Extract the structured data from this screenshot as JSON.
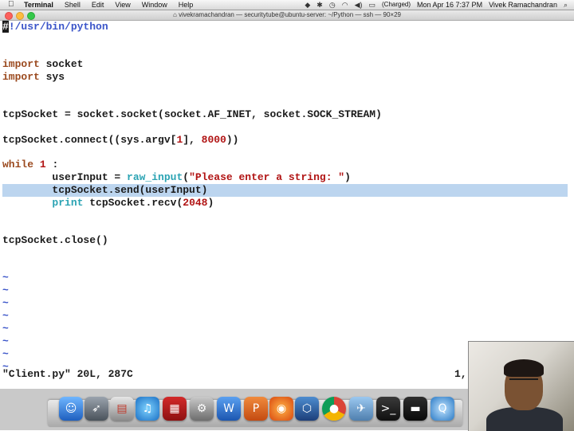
{
  "menubar": {
    "apple": "",
    "app_name": "Terminal",
    "menus": [
      "Shell",
      "Edit",
      "View",
      "Window",
      "Help"
    ],
    "battery": "(Charged)",
    "datetime": "Mon Apr 16  7:37 PM",
    "user": "Vivek Ramachandran"
  },
  "window": {
    "title": "vivekramachandran — securitytube@ubuntu-server: ~/Python — ssh — 90×29"
  },
  "editor": {
    "lines": {
      "shebang_cursor": "#",
      "shebang_rest": "!/usr/bin/python",
      "import1_kw": "import",
      "import1_mod": " socket",
      "import2_kw": "import",
      "import2_mod": " sys",
      "sock_line": "tcpSocket = socket.socket(socket.AF_INET, socket.SOCK_STREAM)",
      "connect_pre": "tcpSocket.connect((sys.argv[",
      "connect_idx": "1",
      "connect_mid": "], ",
      "connect_port": "8000",
      "connect_post": "))",
      "while_kw": "while",
      "while_num": "1",
      "while_colon": " :",
      "input_pre": "        userInput = ",
      "input_fn": "raw_input",
      "input_open": "(",
      "input_str": "\"Please enter a string: \"",
      "input_close": ")",
      "send_line": "        tcpSocket.send(userInput)",
      "print_indent": "        ",
      "print_kw": "print",
      "print_rest": " tcpSocket.recv(",
      "print_num": "2048",
      "print_close": ")",
      "close_line": "tcpSocket.close()"
    },
    "tilde": "~",
    "status_file": "\"Client.py\" 20L, 287C",
    "status_pos": "1,"
  }
}
